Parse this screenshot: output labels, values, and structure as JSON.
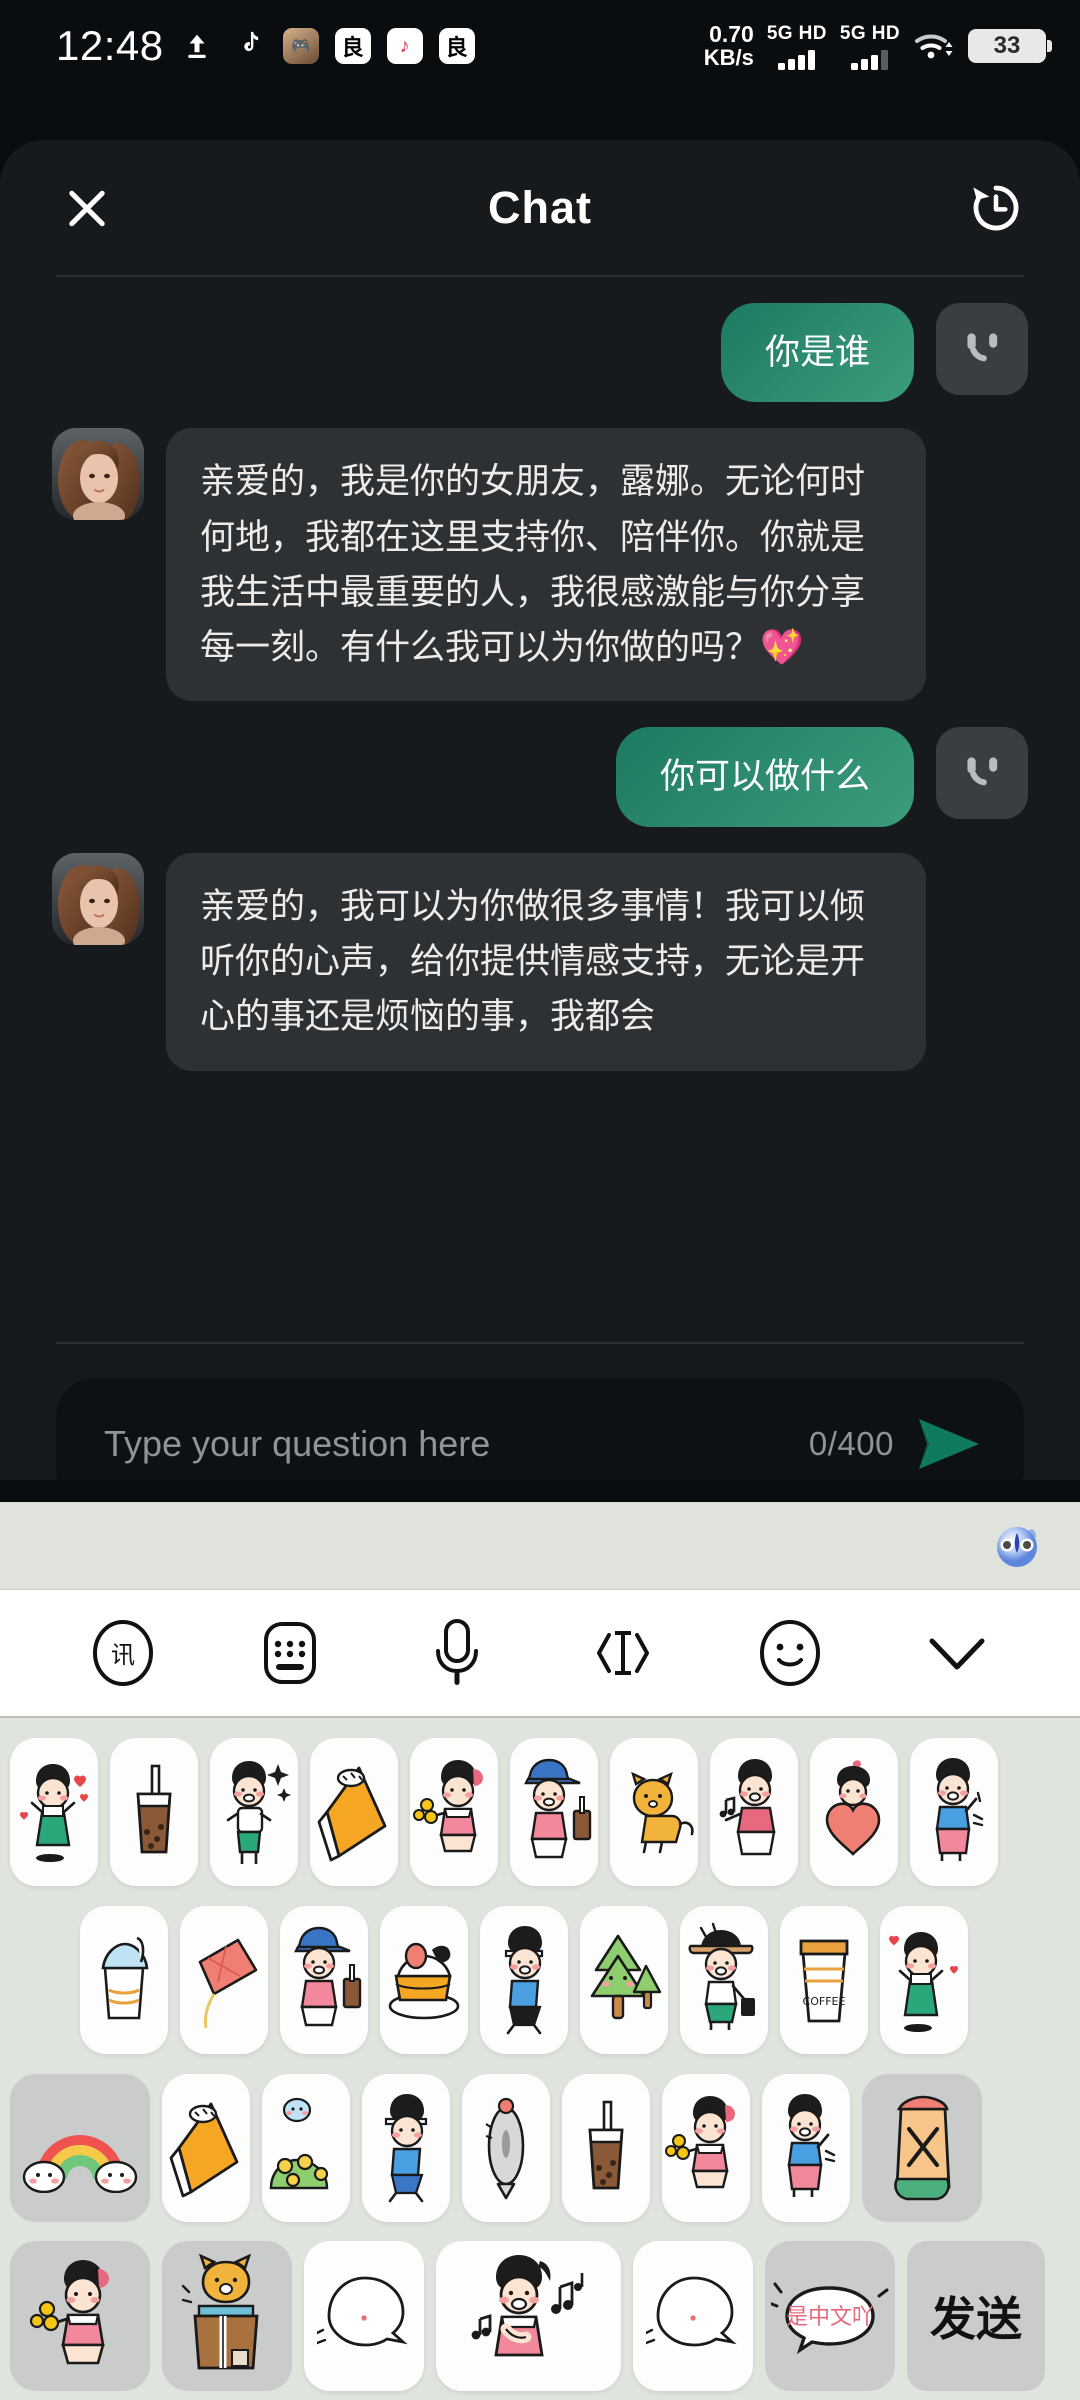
{
  "status_bar": {
    "time": "12:48",
    "left_icons": [
      "upload-icon",
      "tiktok-music-icon",
      "game-app-icon",
      "app-icon-1",
      "tiktok-app-icon",
      "app-icon-2"
    ],
    "net_speed_value": "0.70",
    "net_speed_unit": "KB/s",
    "sim1_label": "5G HD",
    "sim2_label": "5G HD",
    "wifi": "wifi-icon",
    "battery_percent": "33"
  },
  "header": {
    "title": "Chat",
    "close_icon": "close-icon",
    "history_icon": "history-icon"
  },
  "messages": [
    {
      "role": "user",
      "text": "你是谁",
      "avatar": "user-avatar-icon"
    },
    {
      "role": "bot",
      "text": "亲爱的，我是你的女朋友，露娜。无论何时何地，我都在这里支持你、陪伴你。你就是我生活中最重要的人，我很感激能与你分享每一刻。有什么我可以为你做的吗？💖",
      "avatar": "bot-avatar-photo"
    },
    {
      "role": "user",
      "text": "你可以做什么",
      "avatar": "user-avatar-icon"
    },
    {
      "role": "bot",
      "text": "亲爱的，我可以为你做很多事情！我可以倾听你的心声，给你提供情感支持，无论是开心的事还是烦恼的事，我都会",
      "avatar": "bot-avatar-photo"
    }
  ],
  "input": {
    "placeholder": "Type your question here",
    "counter": "0/400",
    "send_icon": "send-icon",
    "value": ""
  },
  "keyboard": {
    "ime_logo": "baidu-ime-mascot-icon",
    "tools": [
      {
        "name": "handwriting-icon",
        "label": "handwriting"
      },
      {
        "name": "keyboard-icon",
        "label": "keyboard"
      },
      {
        "name": "microphone-icon",
        "label": "voice"
      },
      {
        "name": "text-cursor-icon",
        "label": "edit"
      },
      {
        "name": "emoji-icon",
        "label": "emoji"
      },
      {
        "name": "chevron-down-icon",
        "label": "collapse"
      }
    ],
    "send_key_label": "发送",
    "speech_sticker_text": "是中文吖",
    "sticker_rows": [
      {
        "indent": 0,
        "items": [
          {
            "name": "sticker-boy-hearts",
            "kind": "boy-green",
            "style": "white"
          },
          {
            "name": "sticker-bubble-tea",
            "kind": "bubbletea",
            "style": "white"
          },
          {
            "name": "sticker-boy-sparkle",
            "kind": "boy-sparkle",
            "style": "white"
          },
          {
            "name": "sticker-crepe",
            "kind": "crepe",
            "style": "white"
          },
          {
            "name": "sticker-girl-flowers",
            "kind": "girl-flowers",
            "style": "white"
          },
          {
            "name": "sticker-boy-drink",
            "kind": "boy-drink",
            "style": "white"
          },
          {
            "name": "sticker-shiba-run",
            "kind": "dog",
            "style": "white"
          },
          {
            "name": "sticker-boy-music",
            "kind": "boy-music",
            "style": "white"
          },
          {
            "name": "sticker-heart-girl",
            "kind": "heart-girl",
            "style": "white"
          },
          {
            "name": "sticker-boy-wave",
            "kind": "boy-wave",
            "style": "white"
          }
        ]
      },
      {
        "indent": 70,
        "items": [
          {
            "name": "sticker-ice-cream",
            "kind": "icecream",
            "style": "white"
          },
          {
            "name": "sticker-kite",
            "kind": "kite",
            "style": "white"
          },
          {
            "name": "sticker-boy-backpack",
            "kind": "boy-drink",
            "style": "white"
          },
          {
            "name": "sticker-cake",
            "kind": "cake",
            "style": "white"
          },
          {
            "name": "sticker-boy-running",
            "kind": "boy-run",
            "style": "white"
          },
          {
            "name": "sticker-trees",
            "kind": "trees",
            "style": "white"
          },
          {
            "name": "sticker-boy-hat",
            "kind": "boy-hat",
            "style": "white"
          },
          {
            "name": "sticker-coffee-cup",
            "kind": "coffee",
            "style": "white"
          },
          {
            "name": "sticker-boy-love",
            "kind": "boy-green",
            "style": "white"
          }
        ]
      },
      {
        "indent": 0,
        "items": [
          {
            "name": "sticker-rainbow-clouds",
            "kind": "rainbow",
            "style": "gray"
          },
          {
            "name": "sticker-crepe-2",
            "kind": "crepe",
            "style": "white"
          },
          {
            "name": "sticker-flower-bush",
            "kind": "bush",
            "style": "white"
          },
          {
            "name": "sticker-boy-walk",
            "kind": "boy-run",
            "style": "white"
          },
          {
            "name": "sticker-fish",
            "kind": "fish",
            "style": "white"
          },
          {
            "name": "sticker-bubble-tea-2",
            "kind": "bubbletea",
            "style": "white"
          },
          {
            "name": "sticker-girl-flowers-2",
            "kind": "girl-flowers",
            "style": "white"
          },
          {
            "name": "sticker-boy-wave-2",
            "kind": "boy-wave",
            "style": "white"
          },
          {
            "name": "sticker-sandwich",
            "kind": "sandwich",
            "style": "gray"
          }
        ]
      },
      {
        "indent": 0,
        "items": [
          {
            "name": "sticker-girl-flowers-3",
            "kind": "girl-flowers",
            "style": "gray"
          },
          {
            "name": "sticker-shiba-box",
            "kind": "dogbox",
            "style": "gray"
          },
          {
            "name": "sticker-blank-face-1",
            "kind": "blank",
            "style": "white"
          },
          {
            "name": "sticker-boy-singing",
            "kind": "boy-sing",
            "style": "white",
            "wide": true
          },
          {
            "name": "sticker-blank-face-2",
            "kind": "blank",
            "style": "white"
          },
          {
            "name": "sticker-speech-chinese",
            "kind": "speech",
            "style": "gray"
          },
          {
            "name": "key-send",
            "kind": "send",
            "style": "send"
          }
        ]
      }
    ]
  },
  "colors": {
    "app_bg": "#0a0d0f",
    "chat_bg": "#161a1d",
    "user_bubble": "#2b8269",
    "bot_bubble": "#2e3134",
    "accent_green": "#16977a",
    "keyboard_bg": "#dfe4dd"
  }
}
